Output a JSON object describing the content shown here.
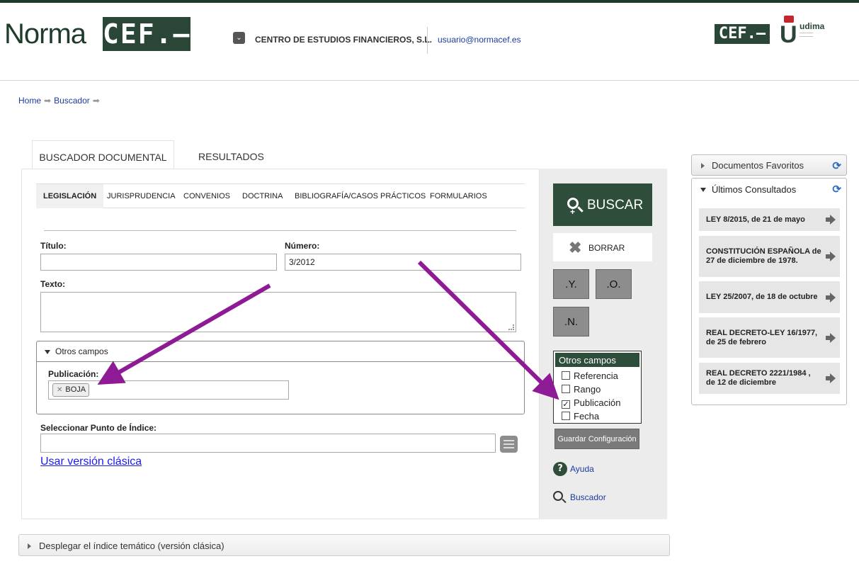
{
  "header": {
    "logo_norma": "Norma",
    "logo_cef": "CEF.–",
    "company": "CENTRO DE ESTUDIOS FINANCIEROS, S.L.",
    "email": "usuario@normacef.es",
    "logo_cef_small": "CEF.–",
    "logo_udima": "udima"
  },
  "breadcrumb": [
    "Home",
    "Buscador"
  ],
  "main_tabs": {
    "active": "BUSCADOR DOCUMENTAL",
    "results": "RESULTADOS"
  },
  "sub_tabs": [
    "LEGISLACIÓN",
    "JURISPRUDENCIA",
    "CONVENIOS",
    "DOCTRINA",
    "BIBLIOGRAFÍA/CASOS PRÁCTICOS",
    "FORMULARIOS"
  ],
  "form": {
    "titulo_label": "Título:",
    "titulo_value": "",
    "numero_label": "Número:",
    "numero_value": "3/2012",
    "texto_label": "Texto:",
    "otros_campos": "Otros campos",
    "publicacion_label": "Publicación:",
    "publicacion_tag": "BOJA",
    "indice_label": "Seleccionar Punto de Índice:",
    "clasica_link": "Usar versión clásica"
  },
  "actions": {
    "buscar": "BUSCAR",
    "borrar": "BORRAR",
    "op_y": ".Y.",
    "op_o": ".O.",
    "op_n": ".N."
  },
  "otros_campos_panel": {
    "title": "Otros campos",
    "options": [
      {
        "label": "Referencia",
        "checked": false
      },
      {
        "label": "Rango",
        "checked": false
      },
      {
        "label": "Publicación",
        "checked": true
      },
      {
        "label": "Fecha",
        "checked": false
      }
    ],
    "guardar": "Guardar Configuración"
  },
  "links": {
    "ayuda": "Ayuda",
    "buscador": "Buscador"
  },
  "bottom_bar": "Desplegar el índice temático (versión clásica)",
  "right": {
    "favoritos": "Documentos Favoritos",
    "ultimos": "Últimos Consultados",
    "items": [
      "LEY 8/2015, de 21 de mayo",
      "CONSTITUCIÓN ESPAÑOLA de 27 de diciembre de 1978.",
      "LEY 25/2007, de 18 de octubre",
      "REAL DECRETO-LEY 16/1977, de 25 de febrero",
      "REAL DECRETO 2221/1984 , de 12 de diciembre"
    ]
  },
  "colors": {
    "brand_green": "#2e4d3a",
    "annotation_arrow": "#8e1a96"
  }
}
